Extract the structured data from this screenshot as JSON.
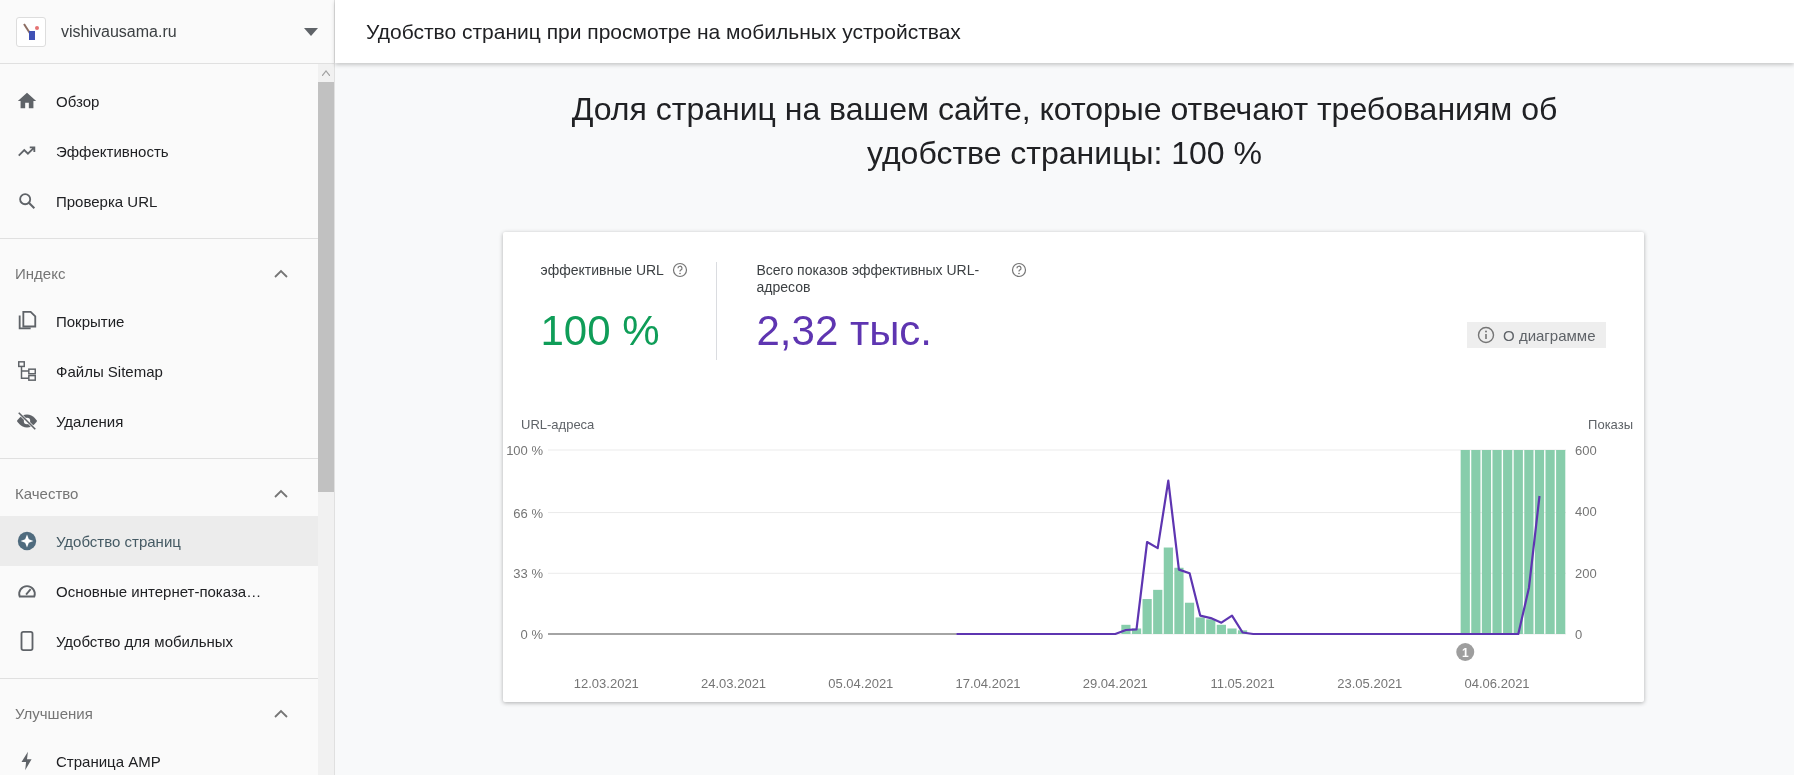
{
  "sidebar": {
    "site": {
      "name": "vishivausama.ru"
    },
    "groups": [
      {
        "items": [
          {
            "label": "Обзор",
            "selected": false
          },
          {
            "label": "Эффективность",
            "selected": false
          },
          {
            "label": "Проверка URL",
            "selected": false
          }
        ]
      },
      {
        "title": "Индекс",
        "expanded": true,
        "items": [
          {
            "label": "Покрытие",
            "selected": false
          },
          {
            "label": "Файлы Sitemap",
            "selected": false
          },
          {
            "label": "Удаления",
            "selected": false
          }
        ]
      },
      {
        "title": "Качество",
        "expanded": true,
        "items": [
          {
            "label": "Удобство страниц",
            "selected": true
          },
          {
            "label": "Основные интернет-показа…",
            "selected": false
          },
          {
            "label": "Удобство для мобильных",
            "selected": false
          }
        ]
      },
      {
        "title": "Улучшения",
        "expanded": true,
        "items": [
          {
            "label": "Страница AMP",
            "selected": false
          }
        ]
      }
    ]
  },
  "header": {
    "title": "Удобство страниц при просмотре на мобильных устройствах"
  },
  "headline": "Доля страниц на вашем сайте, которые отвечают требованиям об удобстве страницы: 100 %",
  "card": {
    "metrics": [
      {
        "label": "эффективные URL",
        "value": "100 %",
        "color": "#0f9d58"
      },
      {
        "label": "Всего показов эффективных URL-адресов",
        "value": "2,32 тыс.",
        "color": "#5e35b1"
      }
    ],
    "about_button": "О диаграмме",
    "chart_data": {
      "type": "bar",
      "ylabel": "URL-адреса",
      "y2label": "Показы",
      "ylim": [
        0,
        100
      ],
      "y2lim": [
        0,
        600
      ],
      "yticks": [
        {
          "value": 0,
          "label": "0 %"
        },
        {
          "value": 33,
          "label": "33 %"
        },
        {
          "value": 66,
          "label": "66 %"
        },
        {
          "value": 100,
          "label": "100 %"
        }
      ],
      "y2ticks": [
        0,
        200,
        400,
        600
      ],
      "categories": [
        null,
        null,
        null,
        null,
        null,
        "12.03.2021",
        null,
        null,
        null,
        null,
        null,
        null,
        null,
        null,
        null,
        null,
        null,
        "24.03.2021",
        null,
        null,
        null,
        null,
        null,
        null,
        null,
        null,
        null,
        null,
        null,
        "05.04.2021",
        null,
        null,
        null,
        null,
        null,
        null,
        null,
        null,
        null,
        null,
        null,
        "17.04.2021",
        null,
        null,
        null,
        null,
        null,
        null,
        null,
        null,
        null,
        null,
        null,
        "29.04.2021",
        null,
        null,
        null,
        null,
        null,
        null,
        null,
        null,
        null,
        null,
        null,
        "11.05.2021",
        null,
        null,
        null,
        null,
        null,
        null,
        null,
        null,
        null,
        null,
        null,
        "23.05.2021",
        null,
        null,
        null,
        null,
        null,
        null,
        null,
        null,
        null,
        null,
        null,
        "04.06.2021",
        null,
        null,
        null,
        null,
        null,
        null
      ],
      "series": [
        {
          "color": "#87cdab",
          "values": [
            null,
            null,
            null,
            null,
            null,
            null,
            null,
            null,
            null,
            null,
            null,
            null,
            null,
            null,
            null,
            null,
            null,
            null,
            null,
            null,
            null,
            null,
            null,
            null,
            null,
            null,
            null,
            null,
            null,
            null,
            null,
            null,
            null,
            null,
            null,
            null,
            null,
            null,
            0,
            0,
            0,
            0,
            0,
            0,
            0,
            0,
            0,
            0,
            0,
            0,
            0,
            0,
            0,
            0,
            5,
            3,
            19,
            24,
            47,
            36,
            17,
            9,
            8,
            5,
            3,
            2,
            0,
            0,
            0,
            0,
            0,
            0,
            0,
            0,
            0,
            0,
            0,
            0,
            0,
            0,
            0,
            0,
            0,
            0,
            0,
            0,
            100,
            100,
            100,
            100,
            100,
            100,
            100,
            100,
            100,
            100
          ]
        },
        {
          "type": "line",
          "axis": "y2",
          "color": "#5e35b1",
          "values": [
            null,
            null,
            null,
            null,
            null,
            null,
            null,
            null,
            null,
            null,
            null,
            null,
            null,
            null,
            null,
            null,
            null,
            null,
            null,
            null,
            null,
            null,
            null,
            null,
            null,
            null,
            null,
            null,
            null,
            null,
            null,
            null,
            null,
            null,
            null,
            null,
            null,
            null,
            0,
            0,
            0,
            0,
            0,
            0,
            0,
            0,
            0,
            0,
            0,
            0,
            0,
            0,
            0,
            0,
            13,
            15,
            300,
            280,
            500,
            210,
            198,
            60,
            52,
            37,
            60,
            5,
            0,
            0,
            0,
            0,
            0,
            0,
            0,
            0,
            0,
            0,
            0,
            0,
            0,
            0,
            0,
            0,
            0,
            0,
            0,
            0,
            0,
            0,
            0,
            0,
            0,
            0,
            150,
            450,
            null,
            null
          ]
        }
      ],
      "annotations": [
        "1"
      ]
    }
  }
}
